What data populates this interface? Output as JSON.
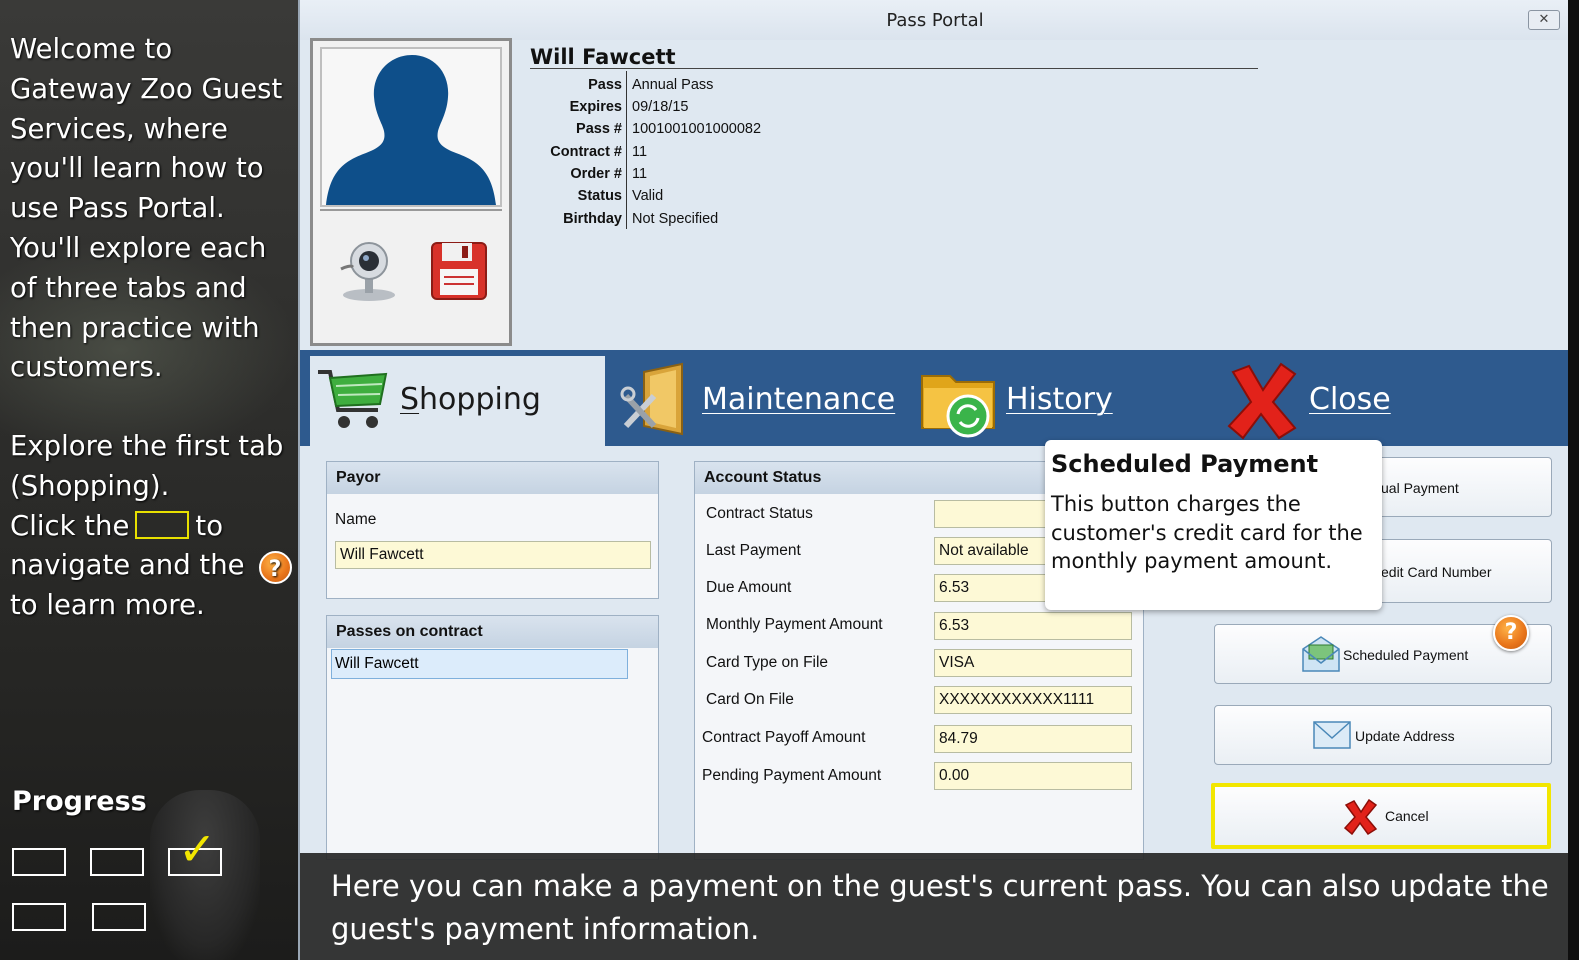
{
  "tutorial": {
    "intro_lines": [
      "Welcome to",
      "Gateway Zoo Guest",
      "Services, where",
      "you'll learn how to",
      "use Pass Portal.",
      "You'll explore each",
      "of three tabs and",
      "then practice with",
      "customers."
    ],
    "explore_line1": "Explore the first tab",
    "explore_line2": "(Shopping).",
    "click_the": "Click the",
    "to": "to",
    "navigate_and_the": "navigate  and the",
    "help_glyph": "?",
    "to_learn_more": "to learn more.",
    "progress_title": "Progress",
    "progress": {
      "completed": 1,
      "total": 5
    },
    "check_glyph": "✓"
  },
  "window": {
    "title": "Pass Portal",
    "close_glyph": "✕"
  },
  "pass": {
    "name": "Will Fawcett",
    "rows": [
      {
        "label": "Pass",
        "value": "Annual Pass"
      },
      {
        "label": "Expires",
        "value": "09/18/15"
      },
      {
        "label": "Pass #",
        "value": "1001001001000082"
      },
      {
        "label": "Contract #",
        "value": "11"
      },
      {
        "label": "Order #",
        "value": "11"
      },
      {
        "label": "Status",
        "value": "Valid"
      },
      {
        "label": "Birthday",
        "value": "Not Specified"
      }
    ]
  },
  "tabs": {
    "shopping_first": "S",
    "shopping_rest": "hopping",
    "maintenance": "Maintenance",
    "history": "History",
    "close": "Close"
  },
  "payor": {
    "heading": "Payor",
    "name_label": "Name",
    "name_value": "Will Fawcett"
  },
  "passes": {
    "heading": "Passes on contract",
    "items": [
      "Will Fawcett"
    ]
  },
  "account": {
    "heading": "Account Status",
    "rows": [
      {
        "label": "Contract Status",
        "value": ""
      },
      {
        "label": "Last Payment",
        "value": "Not available"
      },
      {
        "label": "Due Amount",
        "value": "6.53"
      },
      {
        "label": "Monthly Payment Amount",
        "value": "6.53"
      },
      {
        "label": "Card Type on File",
        "value": "VISA"
      },
      {
        "label": "Card On File",
        "value": "XXXXXXXXXXXX1111"
      },
      {
        "label": "Contract Payoff Amount",
        "value": "84.79"
      },
      {
        "label": "Pending Payment Amount",
        "value": "0.00"
      }
    ]
  },
  "actions": {
    "manual_payment": "ual Payment",
    "credit_card": "edit Card Number",
    "scheduled_payment": "Scheduled Payment",
    "update_address": "Update Address",
    "cancel": "Cancel"
  },
  "tooltip": {
    "title": "Scheduled Payment",
    "body": "This button charges the customer's credit card for the monthly payment amount."
  },
  "help_marker": "?",
  "caption": "Here you can make a payment on the guest's current pass. You can also update the guest's payment information.",
  "colors": {
    "tab_strip": "#2e5a8e",
    "highlight": "#f2e600",
    "field_bg": "#fdf9d6",
    "silhouette": "#0e4f8a"
  }
}
